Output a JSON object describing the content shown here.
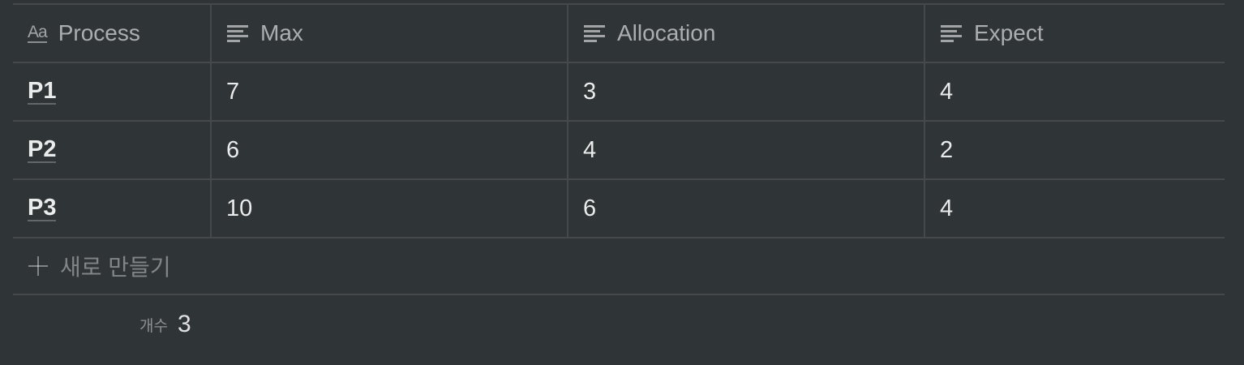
{
  "table": {
    "columns": [
      {
        "label": "Process",
        "icon": "title-aa-icon"
      },
      {
        "label": "Max",
        "icon": "text-lines-icon"
      },
      {
        "label": "Allocation",
        "icon": "text-lines-icon"
      },
      {
        "label": "Expect",
        "icon": "text-lines-icon"
      }
    ],
    "rows": [
      [
        "P1",
        "7",
        "3",
        "4"
      ],
      [
        "P2",
        "6",
        "4",
        "2"
      ],
      [
        "P3",
        "10",
        "6",
        "4"
      ]
    ]
  },
  "new_row_label": "새로 만들기",
  "footer": {
    "count_label": "개수",
    "count_value": "3"
  },
  "header_aa_glyph": "Aa",
  "colors": {
    "background": "#2f3437",
    "divider": "#45494c"
  }
}
